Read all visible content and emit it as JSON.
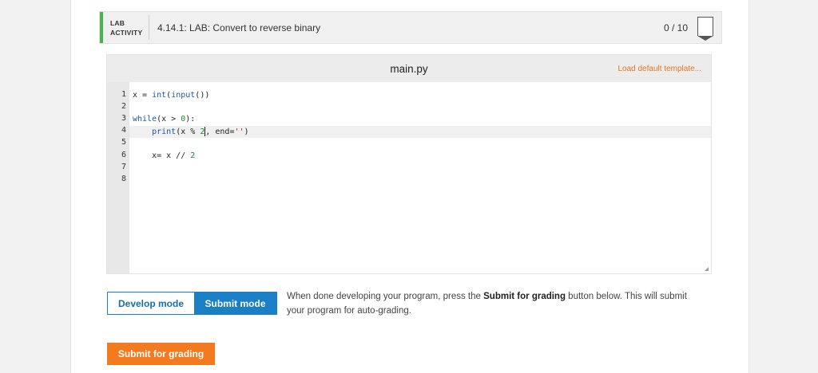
{
  "lab": {
    "type_line1": "LAB",
    "type_line2": "ACTIVITY",
    "title": "4.14.1: LAB: Convert to reverse binary",
    "score": "0 / 10",
    "accent_color": "#4caf50",
    "score_icon": "badge-icon"
  },
  "editor": {
    "filename": "main.py",
    "load_template": "Load default template...",
    "line_numbers": [
      "1",
      "2",
      "3",
      "4",
      "5",
      "6",
      "7",
      "8"
    ],
    "active_line": 4
  },
  "mode": {
    "develop_label": "Develop mode",
    "submit_label": "Submit mode",
    "description_prefix": "When done developing your program, press the ",
    "description_bold": "Submit for grading",
    "description_suffix": " button below. This will submit your program for auto-grading."
  },
  "submit_button": "Submit for grading",
  "colors": {
    "accent_blue": "#1a7fc4",
    "accent_orange": "#f37a1f",
    "keyword_blue": "#2255aa",
    "number_green": "#228833",
    "string_red": "#aa2222"
  }
}
